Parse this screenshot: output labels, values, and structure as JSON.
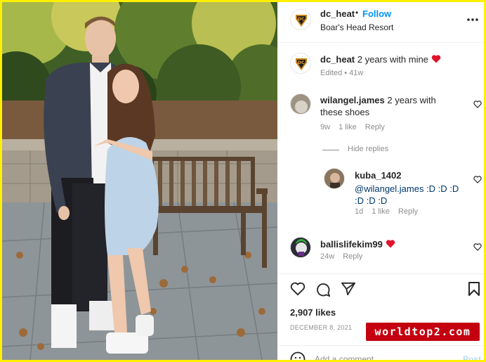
{
  "post": {
    "username": "dc_heat",
    "dot": "•",
    "follow_label": "Follow",
    "location": "Boar's Head Resort",
    "more_icon": "more-horizontal-icon"
  },
  "caption": {
    "username": "dc_heat",
    "text": "2 years with mine",
    "emoji": "red-heart-emoji",
    "meta": "Edited • 41w"
  },
  "comments": [
    {
      "username": "wilangel.james",
      "text": "2 years with these shoes",
      "time": "9w",
      "likes": "1 like",
      "reply": "Reply",
      "hide_replies": "Hide replies"
    },
    {
      "username": "kuba_1402",
      "text": "@wilangel.james :D :D :D :D :D :D",
      "time": "1d",
      "likes": "1 like",
      "reply": "Reply"
    },
    {
      "username": "ballislifekim99",
      "emoji": "red-heart-emoji",
      "time": "24w",
      "reply": "Reply"
    }
  ],
  "footer": {
    "likes": "2,907 likes",
    "date": "DECEMBER 8, 2021",
    "comment_placeholder": "Add a comment…",
    "post_label": "Post"
  },
  "watermark": "worldtop2.com",
  "colors": {
    "accent": "#0095f6",
    "heart": "#ed4956",
    "frame": "#ffef00",
    "watermark_bg": "#c40010"
  }
}
